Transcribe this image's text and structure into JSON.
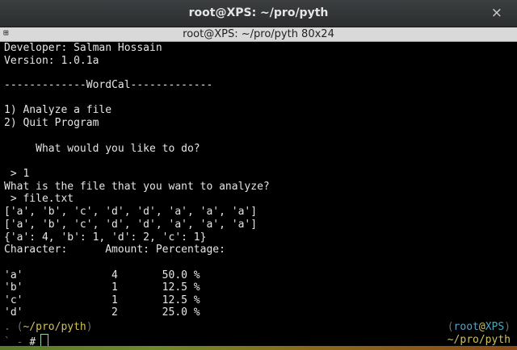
{
  "window": {
    "title": "root@XPS: ~/pro/pyth",
    "close_glyph": "×"
  },
  "terminal_bar": {
    "menu_glyph": "⊞",
    "title": "root@XPS: ~/pro/pyth 80x24"
  },
  "output": [
    "Developer: Salman Hossain",
    "Version: 1.0.1a",
    "",
    "-------------WordCal-------------",
    "",
    "1) Analyze a file",
    "2) Quit Program",
    "",
    "     What would you like to do?",
    "",
    " > 1",
    "What is the file that you want to analyze?",
    " > file.txt",
    "['a', 'b', 'c', 'd', 'd', 'a', 'a', 'a']",
    "['a', 'b', 'c', 'd', 'd', 'a', 'a', 'a']",
    "{'a': 4, 'b': 1, 'd': 2, 'c': 1}",
    "Character:      Amount: Percentage:",
    "",
    "'a'              4       50.0 %",
    "'b'              1       12.5 %",
    "'c'              1       12.5 %",
    "'d'              2       25.0 %"
  ],
  "prompt": {
    "line1_prefix": ". (",
    "path": "~/pro/pyth",
    "line1_suffix": ")",
    "line2_prefix": "` - ",
    "symbol": "#",
    "right_user": "root",
    "right_at": "@",
    "right_host": "XPS",
    "right_path": "~/pro/pyth",
    "open_paren": "(",
    "close_paren": ")"
  }
}
